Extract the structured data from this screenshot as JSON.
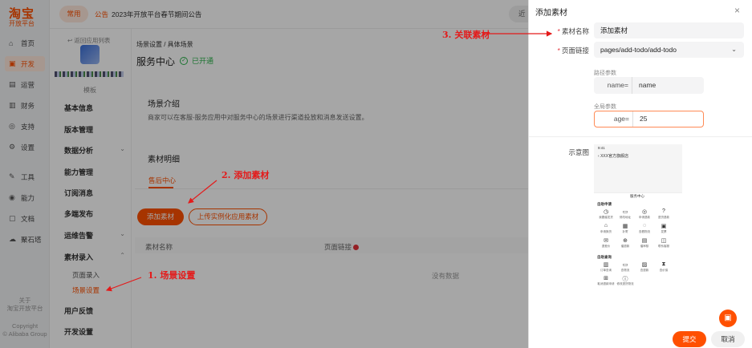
{
  "rail": {
    "logo": "淘宝",
    "logo_sub": "开放平台",
    "items": [
      {
        "label": "首页",
        "icon": "home-icon",
        "glyph": "⌂"
      },
      {
        "label": "开发",
        "icon": "code-icon",
        "glyph": "▣"
      },
      {
        "label": "运营",
        "icon": "operate-icon",
        "glyph": "▤"
      },
      {
        "label": "财务",
        "icon": "finance-icon",
        "glyph": "▥"
      },
      {
        "label": "支持",
        "icon": "support-icon",
        "glyph": "◎"
      },
      {
        "label": "设置",
        "icon": "gear-icon",
        "glyph": "⚙"
      },
      {
        "label": "工具",
        "icon": "tool-icon",
        "glyph": "✎"
      },
      {
        "label": "能力",
        "icon": "ability-icon",
        "glyph": "◉"
      },
      {
        "label": "文档",
        "icon": "doc-icon",
        "glyph": "▢"
      },
      {
        "label": "聚石塔",
        "icon": "cloud-icon",
        "glyph": "☁"
      }
    ],
    "about": "关于",
    "about_sub": "淘宝开放平台",
    "copyright": "Copyright",
    "copyright_sub": "© Alibaba Group"
  },
  "topbar": {
    "tag": "常用",
    "notice_label": "公告",
    "notice_text": "2023年开放平台春节期间公告",
    "recent": "近"
  },
  "subnav": {
    "back": "↩ 返回应用列表",
    "app_type": "模板",
    "items": [
      {
        "label": "基本信息",
        "chev": ""
      },
      {
        "label": "版本管理",
        "chev": ""
      },
      {
        "label": "数据分析",
        "chev": "⌄"
      },
      {
        "label": "能力管理",
        "chev": ""
      },
      {
        "label": "订阅消息",
        "chev": ""
      },
      {
        "label": "多端发布",
        "chev": ""
      },
      {
        "label": "运维告警",
        "chev": "⌄"
      },
      {
        "label": "素材录入",
        "chev": "⌃"
      }
    ],
    "children": [
      "页面录入",
      "场景设置"
    ],
    "items_after": [
      "用户反馈",
      "开发设置"
    ]
  },
  "main": {
    "breadcrumb": "场景设置 / 具体场景",
    "title": "服务中心",
    "status": "已开通",
    "intro_title": "场景介绍",
    "intro_desc": "商家可以在客服-服务应用中对服务中心的场景进行渠道投放和消息发送设置。",
    "material_title": "素材明细",
    "tab": "售后中心",
    "add_btn": "添加素材",
    "upload_btn": "上传实例化应用素材",
    "col_name": "素材名称",
    "col_link": "页面链接",
    "empty": "没有数据"
  },
  "drawer": {
    "title": "添加素材",
    "close": "×",
    "name_label": "素材名称",
    "name_value": "添加素材",
    "link_label": "页面链接",
    "link_value": "pages/add-todo/add-todo",
    "path_params_label": "路径参数",
    "path_key": "name=",
    "path_value": "name",
    "global_params_label": "全局参数",
    "global_key": "age=",
    "global_value": "25",
    "preview_label": "示意图",
    "submit": "提交",
    "cancel": "取消"
  },
  "phone": {
    "time": "9:41",
    "header": "XXX官方旗舰店",
    "service_center": "服务中心",
    "section1": "自助申请",
    "section2": "自助查询",
    "icons_row1": [
      "我要催发货",
      "修改地址",
      "申请退款",
      "退货退款"
    ],
    "icons_row2": [
      "申请换货",
      "补寄",
      "查看物流",
      "发票"
    ],
    "icons_row3": [
      "退差价",
      "催退款",
      "催审核",
      "联系客服"
    ],
    "icons_row4": [
      "订单查询",
      "查物流",
      "查退款",
      "查价保"
    ],
    "icons_row5": [
      "取消退款申请",
      "修改退货物流"
    ]
  },
  "annotations": {
    "a1": "1. 场景设置",
    "a2": "2. 添加素材",
    "a3": "3. 关联素材",
    "color": "#e41a1a"
  },
  "colors": {
    "brand": "#ff5000",
    "success": "#2bb34b",
    "required": "#e4323a"
  }
}
